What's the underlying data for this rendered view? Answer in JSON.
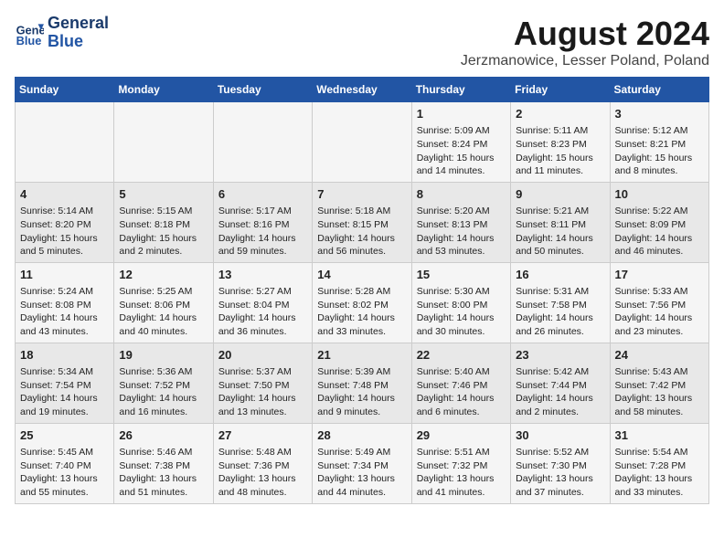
{
  "header": {
    "logo_line1": "General",
    "logo_line2": "Blue",
    "title": "August 2024",
    "subtitle": "Jerzmanowice, Lesser Poland, Poland"
  },
  "weekdays": [
    "Sunday",
    "Monday",
    "Tuesday",
    "Wednesday",
    "Thursday",
    "Friday",
    "Saturday"
  ],
  "weeks": [
    [
      {
        "day": "",
        "info": ""
      },
      {
        "day": "",
        "info": ""
      },
      {
        "day": "",
        "info": ""
      },
      {
        "day": "",
        "info": ""
      },
      {
        "day": "1",
        "info": "Sunrise: 5:09 AM\nSunset: 8:24 PM\nDaylight: 15 hours\nand 14 minutes."
      },
      {
        "day": "2",
        "info": "Sunrise: 5:11 AM\nSunset: 8:23 PM\nDaylight: 15 hours\nand 11 minutes."
      },
      {
        "day": "3",
        "info": "Sunrise: 5:12 AM\nSunset: 8:21 PM\nDaylight: 15 hours\nand 8 minutes."
      }
    ],
    [
      {
        "day": "4",
        "info": "Sunrise: 5:14 AM\nSunset: 8:20 PM\nDaylight: 15 hours\nand 5 minutes."
      },
      {
        "day": "5",
        "info": "Sunrise: 5:15 AM\nSunset: 8:18 PM\nDaylight: 15 hours\nand 2 minutes."
      },
      {
        "day": "6",
        "info": "Sunrise: 5:17 AM\nSunset: 8:16 PM\nDaylight: 14 hours\nand 59 minutes."
      },
      {
        "day": "7",
        "info": "Sunrise: 5:18 AM\nSunset: 8:15 PM\nDaylight: 14 hours\nand 56 minutes."
      },
      {
        "day": "8",
        "info": "Sunrise: 5:20 AM\nSunset: 8:13 PM\nDaylight: 14 hours\nand 53 minutes."
      },
      {
        "day": "9",
        "info": "Sunrise: 5:21 AM\nSunset: 8:11 PM\nDaylight: 14 hours\nand 50 minutes."
      },
      {
        "day": "10",
        "info": "Sunrise: 5:22 AM\nSunset: 8:09 PM\nDaylight: 14 hours\nand 46 minutes."
      }
    ],
    [
      {
        "day": "11",
        "info": "Sunrise: 5:24 AM\nSunset: 8:08 PM\nDaylight: 14 hours\nand 43 minutes."
      },
      {
        "day": "12",
        "info": "Sunrise: 5:25 AM\nSunset: 8:06 PM\nDaylight: 14 hours\nand 40 minutes."
      },
      {
        "day": "13",
        "info": "Sunrise: 5:27 AM\nSunset: 8:04 PM\nDaylight: 14 hours\nand 36 minutes."
      },
      {
        "day": "14",
        "info": "Sunrise: 5:28 AM\nSunset: 8:02 PM\nDaylight: 14 hours\nand 33 minutes."
      },
      {
        "day": "15",
        "info": "Sunrise: 5:30 AM\nSunset: 8:00 PM\nDaylight: 14 hours\nand 30 minutes."
      },
      {
        "day": "16",
        "info": "Sunrise: 5:31 AM\nSunset: 7:58 PM\nDaylight: 14 hours\nand 26 minutes."
      },
      {
        "day": "17",
        "info": "Sunrise: 5:33 AM\nSunset: 7:56 PM\nDaylight: 14 hours\nand 23 minutes."
      }
    ],
    [
      {
        "day": "18",
        "info": "Sunrise: 5:34 AM\nSunset: 7:54 PM\nDaylight: 14 hours\nand 19 minutes."
      },
      {
        "day": "19",
        "info": "Sunrise: 5:36 AM\nSunset: 7:52 PM\nDaylight: 14 hours\nand 16 minutes."
      },
      {
        "day": "20",
        "info": "Sunrise: 5:37 AM\nSunset: 7:50 PM\nDaylight: 14 hours\nand 13 minutes."
      },
      {
        "day": "21",
        "info": "Sunrise: 5:39 AM\nSunset: 7:48 PM\nDaylight: 14 hours\nand 9 minutes."
      },
      {
        "day": "22",
        "info": "Sunrise: 5:40 AM\nSunset: 7:46 PM\nDaylight: 14 hours\nand 6 minutes."
      },
      {
        "day": "23",
        "info": "Sunrise: 5:42 AM\nSunset: 7:44 PM\nDaylight: 14 hours\nand 2 minutes."
      },
      {
        "day": "24",
        "info": "Sunrise: 5:43 AM\nSunset: 7:42 PM\nDaylight: 13 hours\nand 58 minutes."
      }
    ],
    [
      {
        "day": "25",
        "info": "Sunrise: 5:45 AM\nSunset: 7:40 PM\nDaylight: 13 hours\nand 55 minutes."
      },
      {
        "day": "26",
        "info": "Sunrise: 5:46 AM\nSunset: 7:38 PM\nDaylight: 13 hours\nand 51 minutes."
      },
      {
        "day": "27",
        "info": "Sunrise: 5:48 AM\nSunset: 7:36 PM\nDaylight: 13 hours\nand 48 minutes."
      },
      {
        "day": "28",
        "info": "Sunrise: 5:49 AM\nSunset: 7:34 PM\nDaylight: 13 hours\nand 44 minutes."
      },
      {
        "day": "29",
        "info": "Sunrise: 5:51 AM\nSunset: 7:32 PM\nDaylight: 13 hours\nand 41 minutes."
      },
      {
        "day": "30",
        "info": "Sunrise: 5:52 AM\nSunset: 7:30 PM\nDaylight: 13 hours\nand 37 minutes."
      },
      {
        "day": "31",
        "info": "Sunrise: 5:54 AM\nSunset: 7:28 PM\nDaylight: 13 hours\nand 33 minutes."
      }
    ]
  ]
}
